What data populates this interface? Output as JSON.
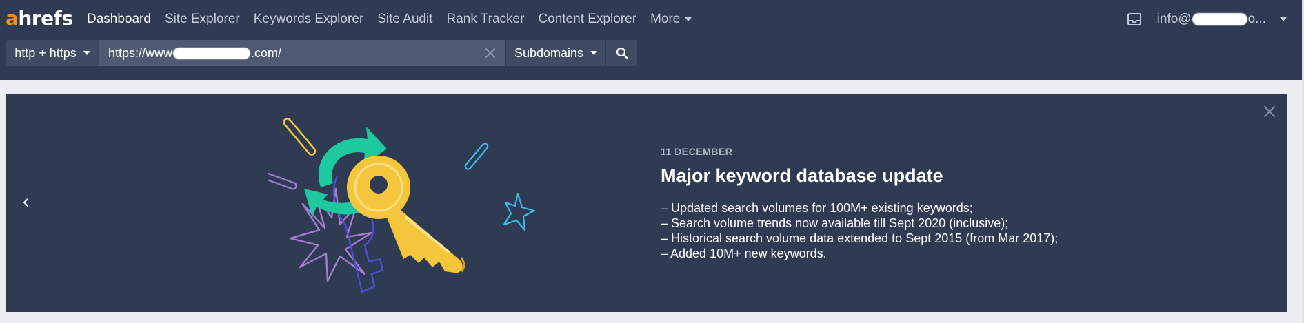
{
  "app": {
    "logo_a": "a",
    "logo_rest": "hrefs"
  },
  "nav": {
    "items": [
      {
        "label": "Dashboard",
        "active": true
      },
      {
        "label": "Site Explorer"
      },
      {
        "label": "Keywords Explorer"
      },
      {
        "label": "Site Audit"
      },
      {
        "label": "Rank Tracker"
      },
      {
        "label": "Content Explorer"
      },
      {
        "label": "More"
      }
    ],
    "account_prefix": "info@",
    "account_suffix": "o..."
  },
  "search": {
    "protocol": "http + https",
    "url_prefix": "https://www",
    "url_suffix": ".com/",
    "mode": "Subdomains"
  },
  "banner": {
    "date": "11 DECEMBER",
    "title": "Major keyword database update",
    "items": [
      "– Updated search volumes for 100M+ existing keywords;",
      "– Search volume trends now available till Sept 2020 (inclusive);",
      "– Historical search volume data extended to Sept 2015 (from Mar 2017);",
      "– Added 10M+ new keywords."
    ]
  },
  "colors": {
    "header_bg": "#2f3b52",
    "brand_orange": "#f68a1f",
    "key_yellow": "#f5c53b",
    "arrow_teal": "#1fc9a0",
    "page_bg": "#eceff1"
  },
  "icons": [
    "inbox-icon",
    "chevron-down-icon",
    "close-icon",
    "search-icon",
    "chevron-left-icon",
    "key-illustration"
  ]
}
